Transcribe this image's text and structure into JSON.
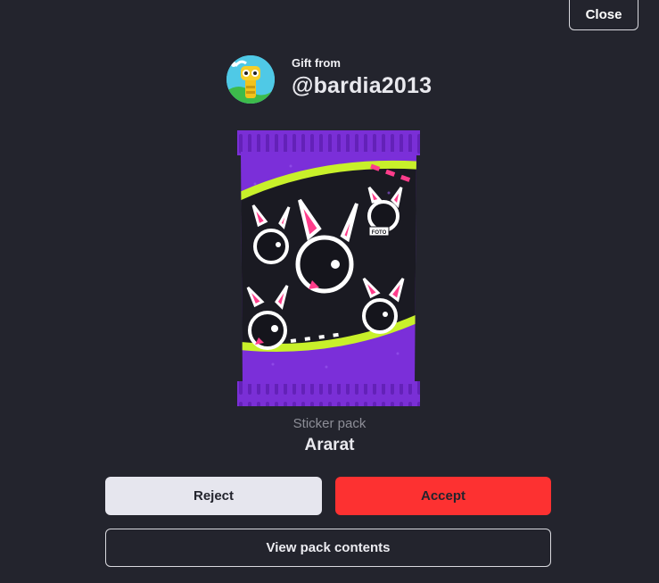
{
  "header": {
    "close_label": "Close"
  },
  "gift": {
    "label": "Gift from",
    "username": "@bardia2013"
  },
  "pack": {
    "kind": "Sticker pack",
    "name": "Ararat",
    "sticker_caption": "FOTO"
  },
  "actions": {
    "reject_label": "Reject",
    "accept_label": "Accept",
    "view_label": "View pack contents"
  },
  "colors": {
    "background": "#23242d",
    "accept": "#fd3131",
    "reject": "#e6e6ee",
    "pack_purple": "#7a2fd6",
    "accent_green": "#c8f02a",
    "accent_pink": "#ff3d8b"
  },
  "icons": {
    "avatar": "yellow-robot-avatar",
    "pack_art": "bunny-sticker-pack-art"
  }
}
